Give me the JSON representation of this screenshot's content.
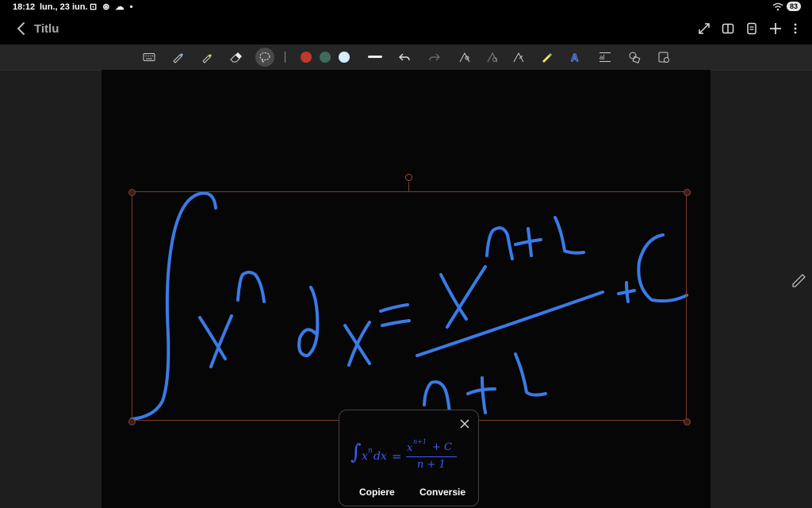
{
  "status": {
    "time": "18:12",
    "date": "lun., 23 iun.",
    "battery": "83"
  },
  "header": {
    "title": "Titlu"
  },
  "toolbar": {
    "colors": [
      "#c0392b",
      "#3d6b5e",
      "#d6ecff"
    ]
  },
  "popup": {
    "formula": {
      "integral": "∫",
      "lhs_base": "x",
      "lhs_exp": "n",
      "lhs_dx": "dx",
      "equals": "=",
      "num_base": "x",
      "num_exp": "n+1",
      "num_tail": "+ C",
      "denominator": "n + 1"
    },
    "copy_label": "Copiere",
    "convert_label": "Conversie"
  },
  "colors": {
    "ink": "#3a7be8",
    "selection": "#7a3a30",
    "formula": "#3e5bff"
  }
}
